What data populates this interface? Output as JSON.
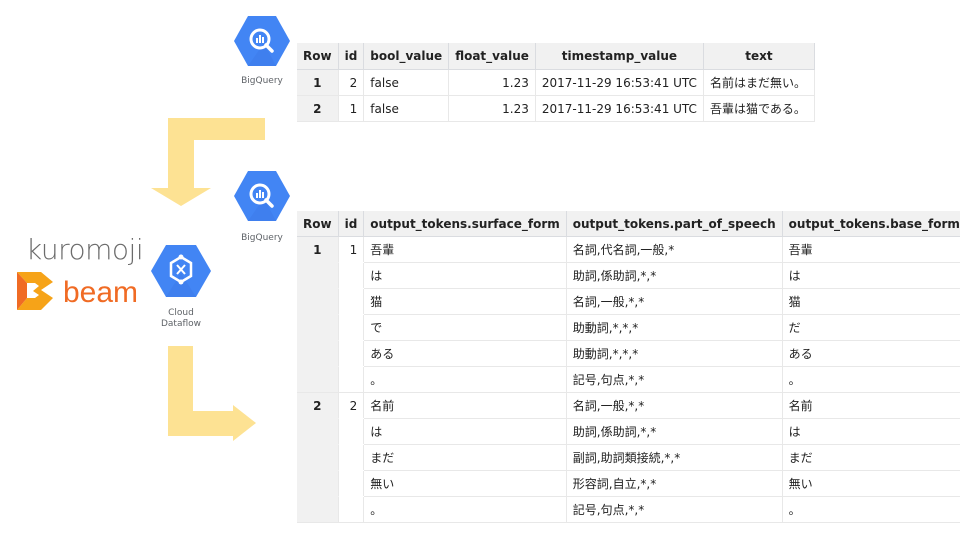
{
  "colors": {
    "gcp_blue": "#4285f4",
    "arrow_yellow": "#fde293",
    "beam_orange": "#f06b24"
  },
  "icons": {
    "bigquery_top": {
      "name": "bigquery-icon",
      "label": "BigQuery"
    },
    "bigquery_mid": {
      "name": "bigquery-icon",
      "label": "BigQuery"
    },
    "dataflow": {
      "name": "cloud-dataflow-icon",
      "label_line1": "Cloud",
      "label_line2": "Dataflow"
    }
  },
  "logos": {
    "kuromoji": "kuromoji",
    "beam": "beam"
  },
  "input_table": {
    "headers": [
      "Row",
      "id",
      "bool_value",
      "float_value",
      "timestamp_value",
      "text"
    ],
    "rows": [
      [
        "1",
        "2",
        "false",
        "1.23",
        "2017-11-29 16:53:41 UTC",
        "名前はまだ無い。"
      ],
      [
        "2",
        "1",
        "false",
        "1.23",
        "2017-11-29 16:53:41 UTC",
        "吾輩は猫である。"
      ]
    ]
  },
  "output_table": {
    "headers": [
      "Row",
      "id",
      "output_tokens.surface_form",
      "output_tokens.part_of_speech",
      "output_tokens.base_form"
    ],
    "groups": [
      {
        "row": "1",
        "id": "1",
        "tokens": [
          {
            "surface": "吾輩",
            "pos": "名詞,代名詞,一般,*",
            "base": "吾輩"
          },
          {
            "surface": "は",
            "pos": "助詞,係助詞,*,*",
            "base": "は"
          },
          {
            "surface": "猫",
            "pos": "名詞,一般,*,*",
            "base": "猫"
          },
          {
            "surface": "で",
            "pos": "助動詞,*,*,*",
            "base": "だ"
          },
          {
            "surface": "ある",
            "pos": "助動詞,*,*,*",
            "base": "ある"
          },
          {
            "surface": "。",
            "pos": "記号,句点,*,*",
            "base": "。"
          }
        ]
      },
      {
        "row": "2",
        "id": "2",
        "tokens": [
          {
            "surface": "名前",
            "pos": "名詞,一般,*,*",
            "base": "名前"
          },
          {
            "surface": "は",
            "pos": "助詞,係助詞,*,*",
            "base": "は"
          },
          {
            "surface": "まだ",
            "pos": "副詞,助詞類接続,*,*",
            "base": "まだ"
          },
          {
            "surface": "無い",
            "pos": "形容詞,自立,*,*",
            "base": "無い"
          },
          {
            "surface": "。",
            "pos": "記号,句点,*,*",
            "base": "。"
          }
        ]
      }
    ]
  }
}
